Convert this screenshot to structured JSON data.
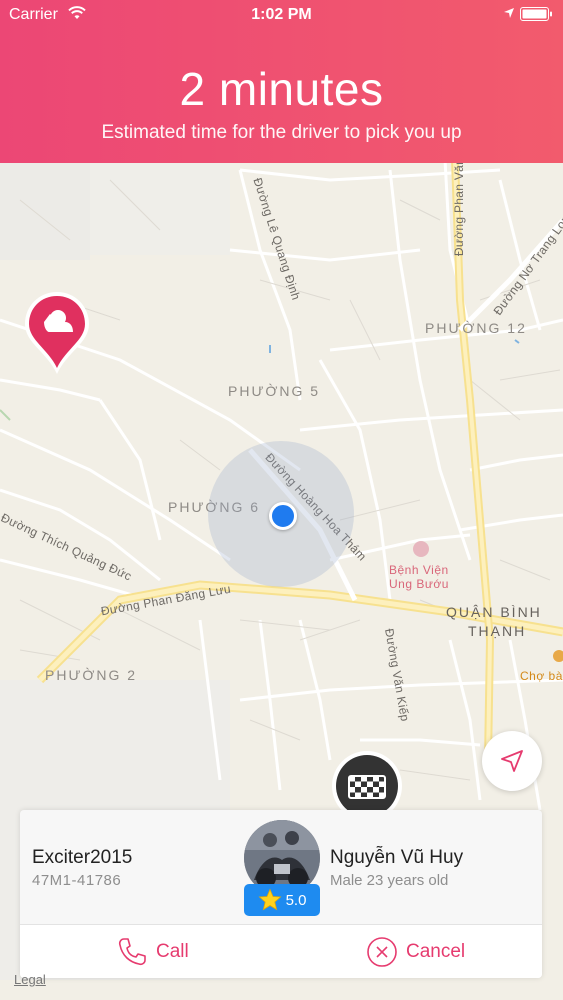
{
  "status_bar": {
    "carrier": "Carrier",
    "time": "1:02 PM"
  },
  "header": {
    "eta": "2 minutes",
    "caption": "Estimated time for the driver to pick you up",
    "gradient": [
      "#ec4775",
      "#f25b6d"
    ]
  },
  "map": {
    "districts": [
      "PHƯỜNG 5",
      "PHƯỜNG 6",
      "PHƯỜNG 12",
      "PHƯỜNG 2",
      "QUẬN BÌNH",
      "THẠNH"
    ],
    "streets": [
      "Đường Lê Quang Định",
      "Đường Phan Văn",
      "Đường Nơ Trang Long",
      "Đường Hoàng Hoa Thám",
      "Đường Phan Đăng Lưu",
      "Đường Văn Kiếp",
      "Đường Thích Quảng Đức"
    ],
    "poi": {
      "hospital_line1": "Bệnh Viện",
      "hospital_line2": "Ung Bướu",
      "market": "Chợ bà"
    },
    "legal": "Legal"
  },
  "driver_card": {
    "vehicle_name": "Exciter2015",
    "plate": "47M1-41786",
    "driver_name": "Nguyễn Vũ Huy",
    "driver_info": "Male 23 years old",
    "rating": "5.0",
    "call_label": "Call",
    "cancel_label": "Cancel"
  },
  "colors": {
    "accent": "#e63b6f",
    "location_dot": "#1f7bef",
    "rating_badge": "#1e8bf0"
  }
}
